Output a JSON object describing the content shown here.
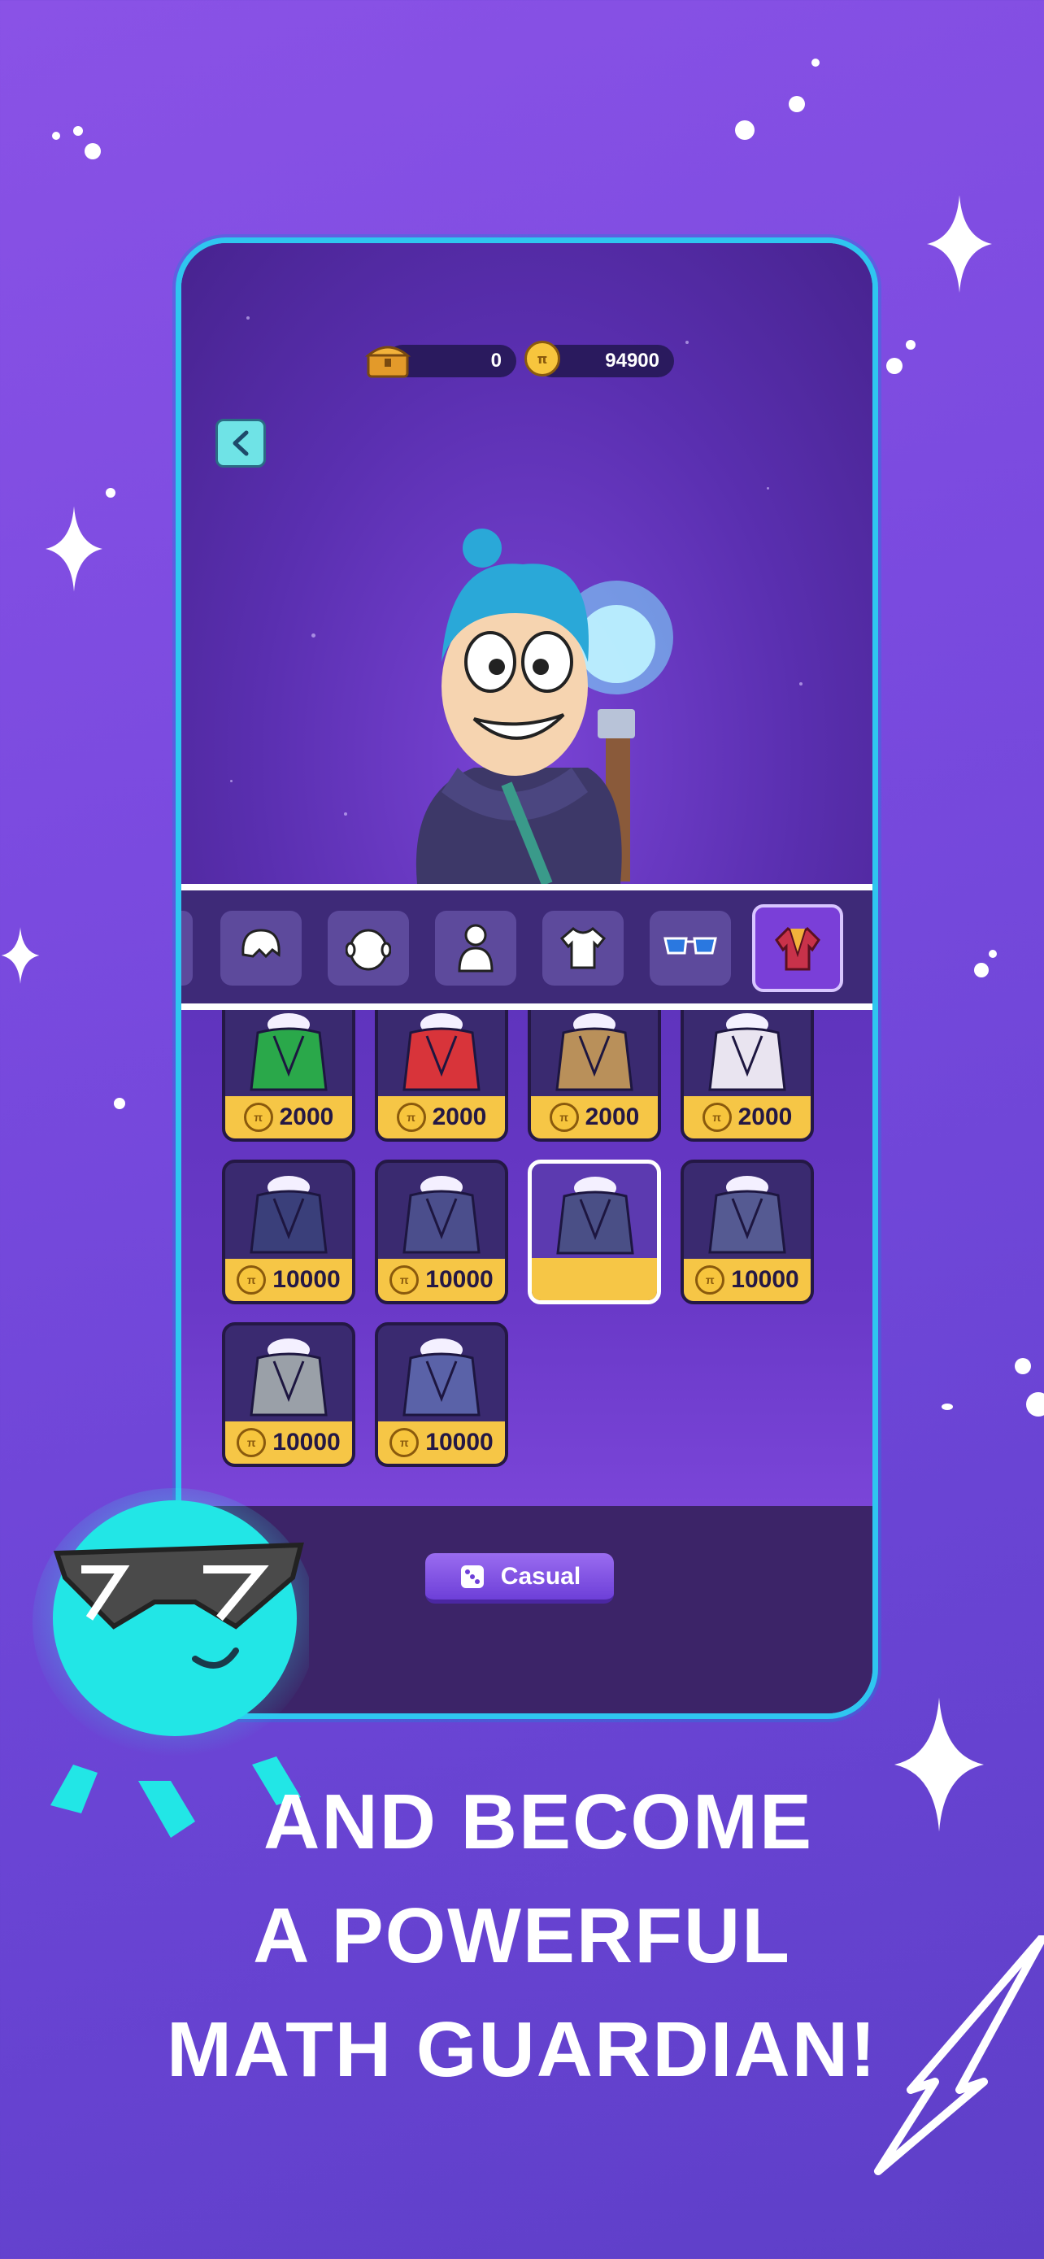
{
  "header": {
    "chest_count": "0",
    "coin_count": "94900"
  },
  "tabs": [
    {
      "icon": "hair-icon"
    },
    {
      "icon": "head-icon"
    },
    {
      "icon": "body-icon"
    },
    {
      "icon": "shirt-icon"
    },
    {
      "icon": "glasses-icon"
    },
    {
      "icon": "outfit-icon",
      "active": true
    }
  ],
  "items": [
    {
      "price": "2000",
      "color": "#2aa84a"
    },
    {
      "price": "2000",
      "color": "#d8343a"
    },
    {
      "price": "2000",
      "color": "#b9905a"
    },
    {
      "price": "2000",
      "color": "#e9e4f0"
    },
    {
      "price": "10000",
      "color": "#3a3f7a"
    },
    {
      "price": "10000",
      "color": "#4b4e8c"
    },
    {
      "price": "",
      "color": "#4a4f86",
      "selected": true
    },
    {
      "price": "10000",
      "color": "#555a92"
    },
    {
      "price": "10000",
      "color": "#9aa0a8"
    },
    {
      "price": "10000",
      "color": "#5a62a8"
    }
  ],
  "mode_button": {
    "label": "Casual"
  },
  "headline": {
    "line1": "AND BECOME",
    "line2": "A POWERFUL",
    "line3": "MATH GUARDIAN!"
  },
  "colors": {
    "accent": "#2fc6f0",
    "price_bar": "#f6c646",
    "mascot": "#22e6e6"
  }
}
